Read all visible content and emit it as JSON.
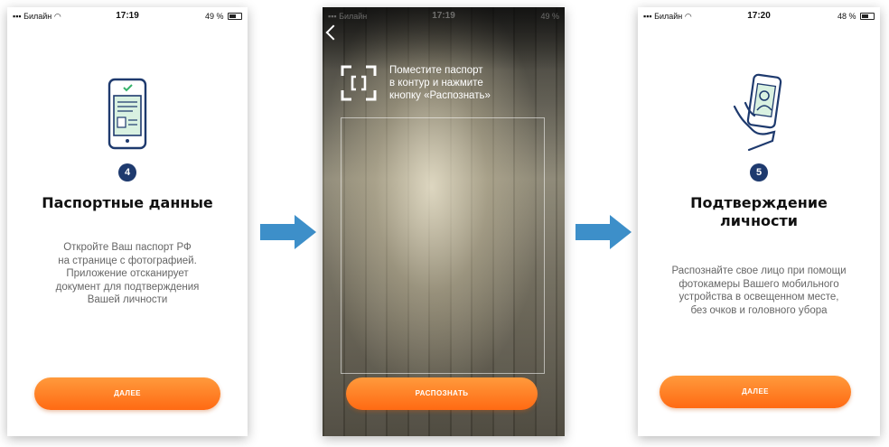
{
  "colors": {
    "accent_orange": "#ff7b22",
    "badge_navy": "#1e3a6e",
    "arrow_blue": "#3d8fc9"
  },
  "screen1": {
    "status": {
      "carrier": "Билайн",
      "time": "17:19",
      "battery": "49 %"
    },
    "illustration_icon": "phone-document-check-icon",
    "step": "4",
    "title": "Паспортные данные",
    "text": "Откройте Ваш паспорт РФ\nна странице с фотографией.\nПриложение отсканирует\nдокумент для подтверждения\nВашей личности",
    "button": "ДАЛЕЕ"
  },
  "screen2": {
    "status": {
      "carrier": "Билайн",
      "time": "17:19",
      "battery": "49 %"
    },
    "hint": "Поместите паспорт\nв контур и нажмите\nкнопку «Распознать»",
    "button": "РАСПОЗНАТЬ"
  },
  "screen3": {
    "status": {
      "carrier": "Билайн",
      "time": "17:20",
      "battery": "48 %"
    },
    "illustration_icon": "hand-phone-face-icon",
    "step": "5",
    "title": "Подтверждение\nличности",
    "text": "Распознайте свое лицо при помощи\nфотокамеры Вашего мобильного\nустройства в освещенном месте,\nбез очков и головного убора",
    "button": "ДАЛЕЕ"
  }
}
